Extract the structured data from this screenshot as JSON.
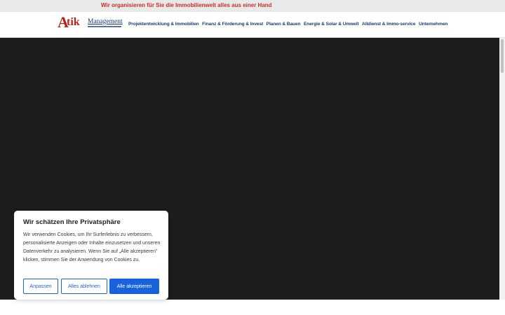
{
  "topbar": {
    "tagline": "Wir organisieren für Sie die Immobilienwelt alles aus einer Hand"
  },
  "logo": {
    "letter_a": "A",
    "letters_tik": "tik",
    "word": "Management"
  },
  "nav": {
    "items": [
      "Projektentwicklung & Immobilien",
      "Finanz & Förderung & Invest",
      "Planen & Bauen",
      "Energie & Solar & Umwelt",
      "Alldienst & Immo-service",
      "Unternehmen"
    ]
  },
  "cookie": {
    "title": "Wir schätzen Ihre Privatsphäre",
    "text": "Wir verwenden Cookies, um Ihr Surferlebnis zu verbessern, personalisierte Anzeigen oder Inhalte einzusetzen und unseren Datenverkehr zu analysieren. Wenn Sie auf „Alle akzeptieren\" klicken, stimmen Sie der Anwendung von Cookies zu.",
    "customize_label": "Anpassen",
    "reject_label": "Alles ablehnen",
    "accept_label": "Alle akzeptieren"
  },
  "colors": {
    "brand_red": "#c8302a",
    "nav_blue": "#1b3d6e",
    "accent_blue": "#1863dc",
    "hero_bg": "#1e1c1c"
  }
}
